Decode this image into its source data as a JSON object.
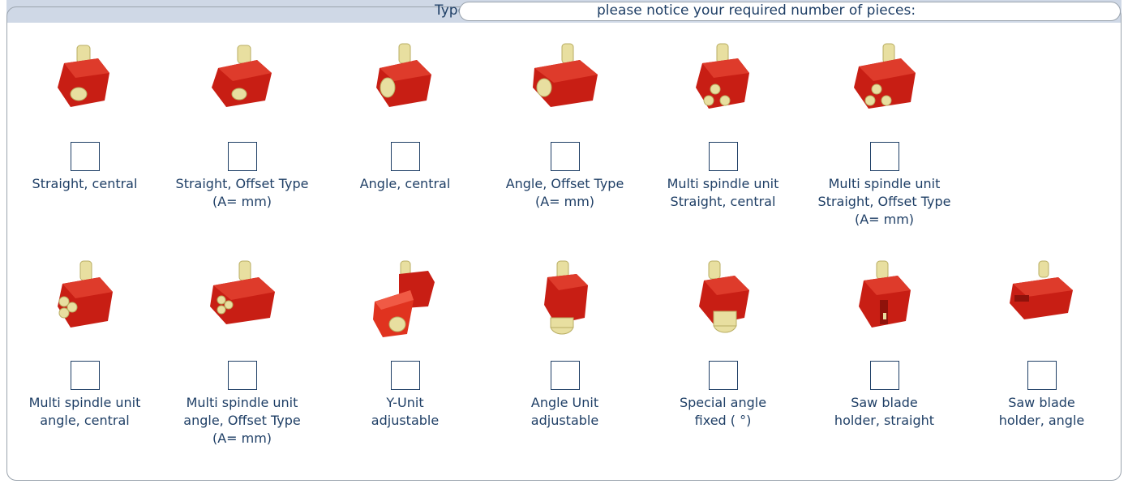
{
  "header": {
    "type_label": "Type",
    "notice": "please notice your required number of pieces:"
  },
  "row1": [
    {
      "name": "straight-central",
      "line1": "Straight, central",
      "line2": "",
      "line3": ""
    },
    {
      "name": "straight-offset",
      "line1": "Straight, Offset Type",
      "line2": "(A=        mm)",
      "line3": ""
    },
    {
      "name": "angle-central",
      "line1": "Angle, central",
      "line2": "",
      "line3": ""
    },
    {
      "name": "angle-offset",
      "line1": "Angle, Offset Type",
      "line2": "(A=        mm)",
      "line3": ""
    },
    {
      "name": "multi-straight-central",
      "line1": "Multi spindle unit",
      "line2": "Straight, central",
      "line3": ""
    },
    {
      "name": "multi-straight-offset",
      "line1": "Multi spindle unit",
      "line2": "Straight, Offset Type",
      "line3": "(A=        mm)"
    }
  ],
  "row2": [
    {
      "name": "multi-angle-central",
      "line1": "Multi spindle unit",
      "line2": "angle, central",
      "line3": ""
    },
    {
      "name": "multi-angle-offset",
      "line1": "Multi spindle unit",
      "line2": "angle, Offset Type",
      "line3": "(A=        mm)"
    },
    {
      "name": "y-unit",
      "line1": "Y-Unit",
      "line2": "adjustable",
      "line3": ""
    },
    {
      "name": "angle-unit",
      "line1": "Angle Unit",
      "line2": "adjustable",
      "line3": ""
    },
    {
      "name": "special-angle",
      "line1": "Special angle",
      "line2": "fixed (        °)",
      "line3": ""
    },
    {
      "name": "saw-straight",
      "line1": "Saw blade",
      "line2": "holder, straight",
      "line3": ""
    },
    {
      "name": "saw-angle",
      "line1": "Saw blade",
      "line2": "holder, angle",
      "line3": ""
    }
  ],
  "colors": {
    "text": "#1f3f66",
    "header_band": "#cfd8e6",
    "body_red": "#c81e14",
    "spindle_cream": "#e8dfa0"
  },
  "icons": [
    "tool-holder-icon"
  ]
}
